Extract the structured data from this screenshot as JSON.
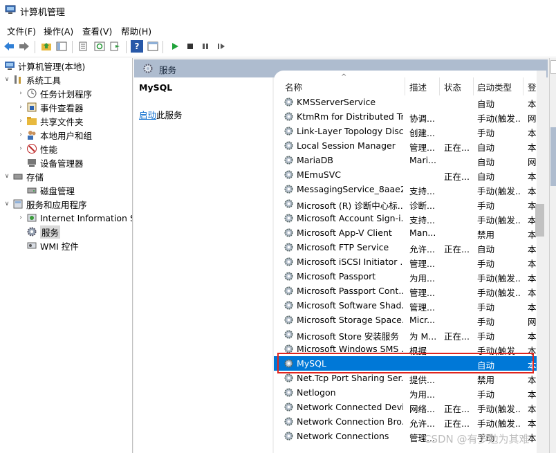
{
  "window": {
    "title": "计算机管理"
  },
  "menu": [
    "文件(F)",
    "操作(A)",
    "查看(V)",
    "帮助(H)"
  ],
  "tree": {
    "root": "计算机管理(本地)",
    "system_tools": "系统工具",
    "task_scheduler": "任务计划程序",
    "event_viewer": "事件查看器",
    "shared_folders": "共享文件夹",
    "local_users": "本地用户和组",
    "performance": "性能",
    "device_manager": "设备管理器",
    "storage": "存储",
    "disk_management": "磁盘管理",
    "services_apps": "服务和应用程序",
    "iis": "Internet Information S",
    "services": "服务",
    "wmi": "WMI 控件"
  },
  "panel": {
    "header": "服务",
    "selected_name": "MySQL",
    "start_link": "启动",
    "start_suffix": "此服务"
  },
  "columns": {
    "name": "名称",
    "desc": "描述",
    "status": "状态",
    "startup": "启动类型",
    "logon": "登"
  },
  "services": [
    {
      "name": "KMSServerService",
      "desc": "",
      "status": "",
      "startup": "自动",
      "logon": "本"
    },
    {
      "name": "KtmRm for Distributed Tr...",
      "desc": "协调...",
      "status": "",
      "startup": "手动(触发...",
      "logon": "网"
    },
    {
      "name": "Link-Layer Topology Disc...",
      "desc": "创建...",
      "status": "",
      "startup": "手动",
      "logon": "本"
    },
    {
      "name": "Local Session Manager",
      "desc": "管理...",
      "status": "正在...",
      "startup": "自动",
      "logon": "本"
    },
    {
      "name": "MariaDB",
      "desc": "Mari...",
      "status": "",
      "startup": "自动",
      "logon": "网"
    },
    {
      "name": "MEmuSVC",
      "desc": "",
      "status": "正在...",
      "startup": "自动",
      "logon": "本"
    },
    {
      "name": "MessagingService_8aae2",
      "desc": "支持...",
      "status": "",
      "startup": "手动(触发...",
      "logon": "本"
    },
    {
      "name": "Microsoft (R) 诊断中心标...",
      "desc": "诊断...",
      "status": "",
      "startup": "手动",
      "logon": "本"
    },
    {
      "name": "Microsoft Account Sign-i...",
      "desc": "支持...",
      "status": "",
      "startup": "手动(触发...",
      "logon": "本"
    },
    {
      "name": "Microsoft App-V Client",
      "desc": "Man...",
      "status": "",
      "startup": "禁用",
      "logon": "本"
    },
    {
      "name": "Microsoft FTP Service",
      "desc": "允许...",
      "status": "正在...",
      "startup": "自动",
      "logon": "本"
    },
    {
      "name": "Microsoft iSCSI Initiator ...",
      "desc": "管理...",
      "status": "",
      "startup": "手动",
      "logon": "本"
    },
    {
      "name": "Microsoft Passport",
      "desc": "为用...",
      "status": "",
      "startup": "手动(触发...",
      "logon": "本"
    },
    {
      "name": "Microsoft Passport Cont...",
      "desc": "管理...",
      "status": "",
      "startup": "手动(触发...",
      "logon": "本"
    },
    {
      "name": "Microsoft Software Shad...",
      "desc": "管理...",
      "status": "",
      "startup": "手动",
      "logon": "本"
    },
    {
      "name": "Microsoft Storage Space...",
      "desc": "Micr...",
      "status": "",
      "startup": "手动",
      "logon": "网"
    },
    {
      "name": "Microsoft Store 安装服务",
      "desc": "为 M...",
      "status": "正在...",
      "startup": "手动",
      "logon": "本"
    },
    {
      "name": "Microsoft Windows SMS ...",
      "desc": "根据...",
      "status": "",
      "startup": "手动(触发...",
      "logon": "本"
    },
    {
      "name": "MySQL",
      "desc": "",
      "status": "",
      "startup": "自动",
      "logon": "本"
    },
    {
      "name": "Net.Tcp Port Sharing Ser...",
      "desc": "提供...",
      "status": "",
      "startup": "禁用",
      "logon": "本"
    },
    {
      "name": "Netlogon",
      "desc": "为用...",
      "status": "",
      "startup": "手动",
      "logon": "本"
    },
    {
      "name": "Network Connected Devi...",
      "desc": "网络...",
      "status": "正在...",
      "startup": "手动(触发...",
      "logon": "本"
    },
    {
      "name": "Network Connection Bro...",
      "desc": "允许...",
      "status": "正在...",
      "startup": "手动(触发...",
      "logon": "本"
    },
    {
      "name": "Network Connections",
      "desc": "管理...",
      "status": "",
      "startup": "手动",
      "logon": "本"
    }
  ],
  "selected_index": 18,
  "colors": {
    "selection": "#0078d7",
    "highlight_box": "#e0251f",
    "header_band": "#aebccf"
  },
  "icons": [
    "computer-icon",
    "back-arrow-icon",
    "forward-arrow-icon",
    "gear-icon",
    "play-icon",
    "stop-icon",
    "pause-icon",
    "resume-icon"
  ],
  "watermark": "CSDN @有多勉为其难"
}
